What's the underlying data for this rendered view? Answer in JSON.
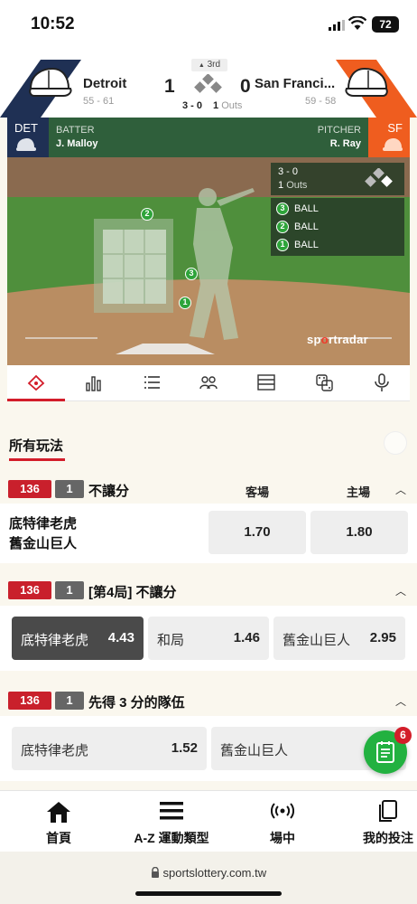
{
  "status_bar": {
    "time": "10:52",
    "battery": "72"
  },
  "scoreboard": {
    "inning": "3rd",
    "away": {
      "name": "Detroit",
      "record": "55 - 61",
      "score": "1",
      "abbr": "DET",
      "color": "#1f3054"
    },
    "home": {
      "name": "San Franci...",
      "record": "59 - 58",
      "score": "0",
      "abbr": "SF",
      "color": "#ef5d1f"
    },
    "count": "3 - 0",
    "outs_num": "1",
    "outs_label": "Outs"
  },
  "batter": {
    "label": "BATTER",
    "name": "J. Malloy"
  },
  "pitcher": {
    "label": "PITCHER",
    "name": "R. Ray"
  },
  "field": {
    "count": "3 - 0",
    "outs_num": "1",
    "outs_label": "Outs",
    "pitches": [
      {
        "num": "3",
        "result": "BALL"
      },
      {
        "num": "2",
        "result": "BALL"
      },
      {
        "num": "1",
        "result": "BALL"
      }
    ],
    "zone_markers": [
      "2",
      "3",
      "1"
    ],
    "brand_pre": "sp",
    "brand_dot": "o",
    "brand_post": "rtradar"
  },
  "tabs": [
    "field-tab",
    "stats-tab",
    "list-tab",
    "lineup-tab",
    "table-tab",
    "dice-tab",
    "mic-tab"
  ],
  "all_plays": {
    "title": "所有玩法"
  },
  "markets": [
    {
      "id": "136",
      "leg": "1",
      "title": "不讓分",
      "col_away": "客場",
      "col_home": "主場",
      "team_away": "底特律老虎",
      "team_home": "舊金山巨人",
      "odds": [
        "1.70",
        "1.80"
      ]
    },
    {
      "id": "136",
      "leg": "1",
      "title": "[第4局] 不讓分",
      "options": [
        {
          "name": "底特律老虎",
          "odd": "4.43",
          "selected": true
        },
        {
          "name": "和局",
          "odd": "1.46",
          "selected": false
        },
        {
          "name": "舊金山巨人",
          "odd": "2.95",
          "selected": false
        }
      ]
    },
    {
      "id": "136",
      "leg": "1",
      "title": "先得 3 分的隊伍",
      "options": [
        {
          "name": "底特律老虎",
          "odd": "1.52"
        },
        {
          "name": "舊金山巨人",
          "odd": ""
        }
      ]
    }
  ],
  "bet_slip": {
    "count": "6"
  },
  "bottom_nav": [
    {
      "label": "首頁"
    },
    {
      "label": "A-Z 運動類型"
    },
    {
      "label": "場中"
    },
    {
      "label": "我的投注"
    }
  ],
  "browser": {
    "url": "sportslottery.com.tw"
  }
}
